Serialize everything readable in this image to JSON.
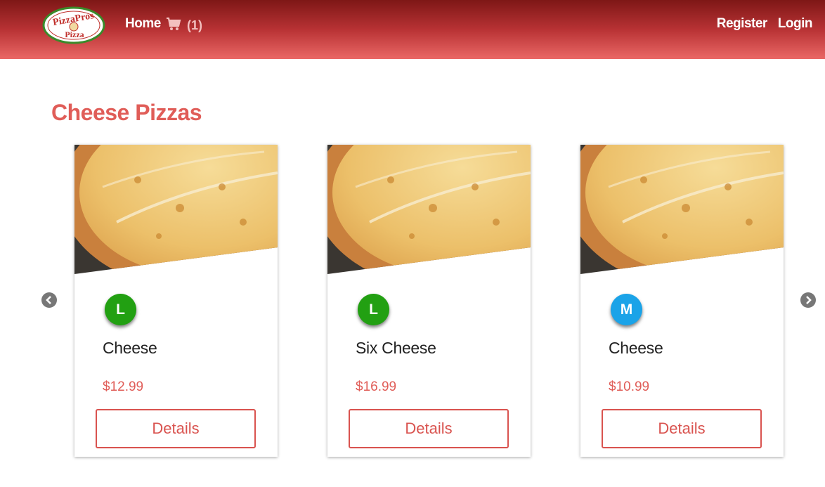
{
  "nav": {
    "logo_text_top": "PizzaPros",
    "logo_text_bottom": "Pizza",
    "home": "Home",
    "cart_icon": "shopping-cart-icon",
    "cart_count": "(1)",
    "register": "Register",
    "login": "Login"
  },
  "section_title": "Cheese Pizzas",
  "colors": {
    "accent": "#d9534f",
    "badge_large": "#22a012",
    "badge_medium": "#1aa3e8"
  },
  "cards": [
    {
      "size": "L",
      "name": "Cheese",
      "price": "$12.99",
      "button": "Details"
    },
    {
      "size": "L",
      "name": "Six Cheese",
      "price": "$16.99",
      "button": "Details"
    },
    {
      "size": "M",
      "name": "Cheese",
      "price": "$10.99",
      "button": "Details"
    }
  ],
  "carousel": {
    "prev_icon": "chevron-left-circle-icon",
    "next_icon": "chevron-right-circle-icon"
  }
}
